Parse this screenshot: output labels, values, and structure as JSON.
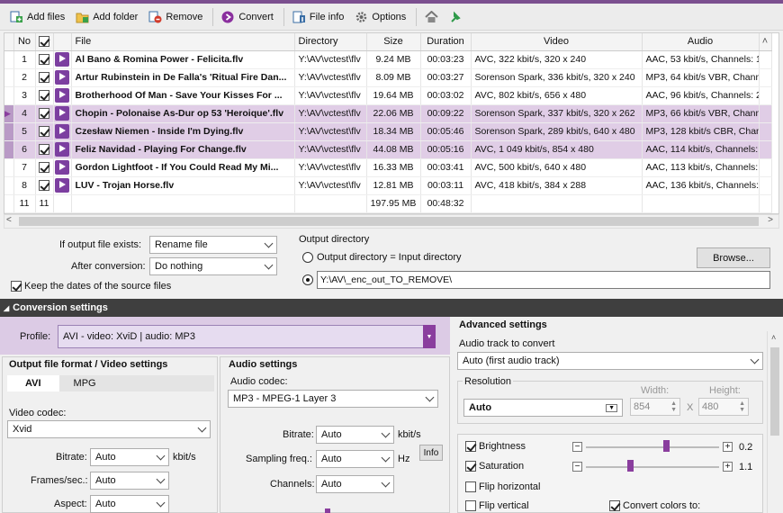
{
  "toolbar": {
    "add_files": "Add files",
    "add_folder": "Add folder",
    "remove": "Remove",
    "convert": "Convert",
    "file_info": "File info",
    "options": "Options"
  },
  "table": {
    "columns": [
      "No",
      "File",
      "Directory",
      "Size",
      "Duration",
      "Video",
      "Audio"
    ],
    "rows": [
      {
        "no": "1",
        "file": "Al Bano & Romina Power - Felicita.flv",
        "dir": "Y:\\AV\\vctest\\flv",
        "size": "9.24 MB",
        "dur": "00:03:23",
        "video": "AVC, 322 kbit/s, 320 x 240",
        "audio": "AAC, 53 kbit/s, Channels: 1"
      },
      {
        "no": "2",
        "file": "Artur Rubinstein in De Falla's 'Ritual Fire Dan...",
        "dir": "Y:\\AV\\vctest\\flv",
        "size": "8.09 MB",
        "dur": "00:03:27",
        "video": "Sorenson Spark, 336 kbit/s, 320 x 240",
        "audio": "MP3, 64 kbit/s VBR, Channels"
      },
      {
        "no": "3",
        "file": "Brotherhood Of Man - Save Your Kisses For ...",
        "dir": "Y:\\AV\\vctest\\flv",
        "size": "19.64 MB",
        "dur": "00:03:02",
        "video": "AVC, 802 kbit/s, 656 x 480",
        "audio": "AAC, 96 kbit/s, Channels: 2"
      },
      {
        "no": "4",
        "file": "Chopin - Polonaise As-Dur op 53 'Heroique'.flv",
        "dir": "Y:\\AV\\vctest\\flv",
        "size": "22.06 MB",
        "dur": "00:09:22",
        "video": "Sorenson Spark, 337 kbit/s, 320 x 262",
        "audio": "MP3, 66 kbit/s VBR, Channe"
      },
      {
        "no": "5",
        "file": "Czesław Niemen - Inside I'm Dying.flv",
        "dir": "Y:\\AV\\vctest\\flv",
        "size": "18.34 MB",
        "dur": "00:05:46",
        "video": "Sorenson Spark, 289 kbit/s, 640 x 480",
        "audio": "MP3, 128 kbit/s CBR, Chann"
      },
      {
        "no": "6",
        "file": "Feliz Navidad - Playing For Change.flv",
        "dir": "Y:\\AV\\vctest\\flv",
        "size": "44.08 MB",
        "dur": "00:05:16",
        "video": "AVC, 1 049 kbit/s, 854 x 480",
        "audio": "AAC, 114 kbit/s, Channels: 2"
      },
      {
        "no": "7",
        "file": "Gordon Lightfoot - If You Could Read My Mi...",
        "dir": "Y:\\AV\\vctest\\flv",
        "size": "16.33 MB",
        "dur": "00:03:41",
        "video": "AVC, 500 kbit/s, 640 x 480",
        "audio": "AAC, 113 kbit/s, Channels: 2"
      },
      {
        "no": "8",
        "file": "LUV - Trojan Horse.flv",
        "dir": "Y:\\AV\\vctest\\flv",
        "size": "12.81 MB",
        "dur": "00:03:11",
        "video": "AVC, 418 kbit/s, 384 x 288",
        "audio": "AAC, 136 kbit/s, Channels: 2"
      }
    ],
    "footer": {
      "count_a": "11",
      "count_b": "11",
      "total_size": "197.95 MB",
      "total_duration": "00:48:32"
    }
  },
  "output": {
    "if_exists_label": "If output file exists:",
    "if_exists_value": "Rename file",
    "after_label": "After conversion:",
    "after_value": "Do nothing",
    "keep_dates": "Keep the dates of the source files",
    "dir_title": "Output directory",
    "radio_input": "Output directory = Input directory",
    "dir_value": "Y:\\AV\\_enc_out_TO_REMOVE\\",
    "browse": "Browse..."
  },
  "conversion": {
    "header": "Conversion settings",
    "profile_label": "Profile:",
    "profile_value": "AVI - video: XviD | audio: MP3",
    "video_section": "Output file format / Video settings",
    "tab_avi": "AVI",
    "tab_mpg": "MPG",
    "video_codec_label": "Video codec:",
    "video_codec_value": "Xvid",
    "bitrate_label": "Bitrate:",
    "bitrate_value": "Auto",
    "bitrate_unit": "kbit/s",
    "fps_label": "Frames/sec.:",
    "fps_value": "Auto",
    "aspect_label": "Aspect:",
    "aspect_value": "Auto",
    "audio_section": "Audio settings",
    "audio_codec_label": "Audio codec:",
    "audio_codec_value": "MP3 - MPEG-1 Layer 3",
    "a_bitrate_label": "Bitrate:",
    "a_bitrate_value": "Auto",
    "a_bitrate_unit": "kbit/s",
    "info": "Info",
    "sampling_label": "Sampling freq.:",
    "sampling_value": "Auto",
    "sampling_unit": "Hz",
    "channels_label": "Channels:",
    "channels_value": "Auto"
  },
  "advanced": {
    "header": "Advanced settings",
    "audio_track_label": "Audio track to convert",
    "audio_track_value": "Auto (first audio track)",
    "resolution_label": "Resolution",
    "resolution_value": "Auto",
    "width_label": "Width:",
    "width_value": "854",
    "height_label": "Height:",
    "height_value": "480",
    "x_label": "X",
    "brightness_label": "Brightness",
    "brightness_value": "0.2",
    "brightness_level": 0.6,
    "saturation_label": "Saturation",
    "saturation_value": "1.1",
    "saturation_level": 0.33,
    "flip_h": "Flip horizontal",
    "flip_v": "Flip vertical",
    "convert_colors": "Convert colors to:"
  },
  "colors": {
    "accent": "#7b4f8f",
    "selection": "#e0cde6"
  }
}
